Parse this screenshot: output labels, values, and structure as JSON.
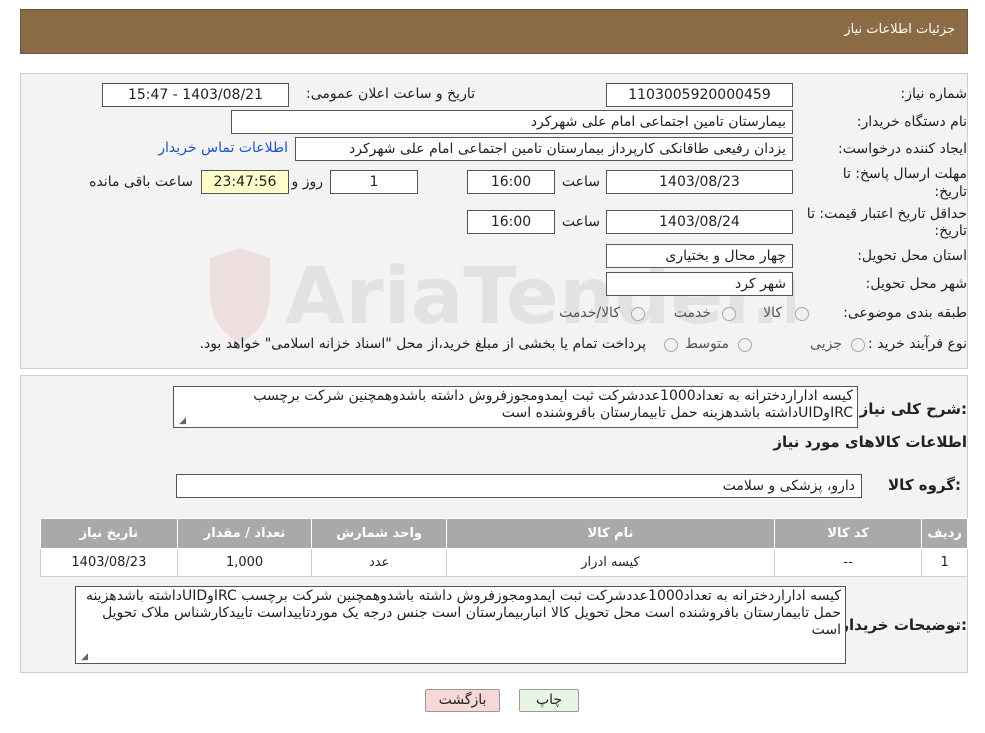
{
  "header": {
    "title": "جزئیات اطلاعات نیاز"
  },
  "need_info": {
    "need_number_label": "شماره نیاز:",
    "need_number": "1103005920000459",
    "announce_label": "تاریخ و ساعت اعلان عمومی:",
    "announce_value": "1403/08/21 - 15:47",
    "buyer_org_label": "نام دستگاه خریدار:",
    "buyer_org": "بیمارستان تامین اجتماعی امام علی شهرکرد",
    "creator_label": "ایجاد کننده درخواست:",
    "creator": "یزدان رفیعی طاقانکی کارپرداز بیمارستان تامین اجتماعی امام علی شهرکرد",
    "contact_link": "اطلاعات تماس خریدار",
    "deadline_label_1": "مهلت ارسال پاسخ: تا",
    "deadline_label_2": "تاریخ:",
    "deadline_date": "1403/08/23",
    "time_label": "ساعت",
    "deadline_time": "16:00",
    "days_value": "1",
    "days_label": "روز و",
    "remaining_time": "23:47:56",
    "remaining_label": "ساعت باقی مانده",
    "validity_label_1": "حداقل تاریخ اعتبار قیمت: تا",
    "validity_label_2": "تاریخ:",
    "validity_date": "1403/08/24",
    "validity_time": "16:00",
    "province_label": "استان محل تحویل:",
    "province": "چهار محال و بختیاری",
    "city_label": "شهر محل تحویل:",
    "city": "شهر کرد",
    "category_label": "طبقه بندی موضوعی:",
    "category_options": [
      "کالا",
      "خدمت",
      "کالا/خدمت"
    ],
    "process_label": "نوع فرآیند خرید :",
    "process_options": [
      "جزیی",
      "متوسط"
    ],
    "process_note": "پرداخت تمام یا بخشی از مبلغ خرید،از محل \"اسناد خزانه اسلامی\" خواهد بود."
  },
  "summary": {
    "label": "شرح کلی نیاز:",
    "text": "کیسه اداراردخترانه به تعداد1000عددشرکت ثبت ایمدومجوزفروش داشته باشدوهمچنین شرکت  برچسب IRCوUIDداشته باشدهزینه حمل تابیمارستان بافروشنده است"
  },
  "goods": {
    "section_title": "اطلاعات کالاهای مورد نیاز",
    "group_label": "گروه کالا:",
    "group_value": "دارو، پزشکی و سلامت",
    "table_headers": [
      "ردیف",
      "کد کالا",
      "نام کالا",
      "واحد شمارش",
      "تعداد / مقدار",
      "تاریخ نیاز"
    ],
    "rows": [
      {
        "row": "1",
        "code": "--",
        "name": "کیسه ادرار",
        "unit": "عدد",
        "qty": "1,000",
        "date": "1403/08/23"
      }
    ]
  },
  "buyer_notes": {
    "label": "توضیحات خریدار:",
    "text": "کیسه اداراردخترانه به تعداد1000عددشرکت ثبت ایمدومجوزفروش داشته باشدوهمچنین شرکت  برچسب IRCوUIDداشته باشدهزینه حمل تابیمارستان بافروشنده است محل تحویل کالا انباربیمارستان است جنس درجه یک موردتاییداست تاییدکارشناس ملاک تحویل است"
  },
  "buttons": {
    "print": "چاپ",
    "back": "بازگشت"
  },
  "watermark": {
    "text": "AriaTender.net"
  },
  "colors": {
    "header_bg": "#8a6b46",
    "panel_bg": "#f3f3f3",
    "time_left_bg": "#ffffcc",
    "back_btn_bg": "#f8d7d7",
    "print_btn_bg": "#e8f5e2",
    "link": "#1b55c0"
  }
}
